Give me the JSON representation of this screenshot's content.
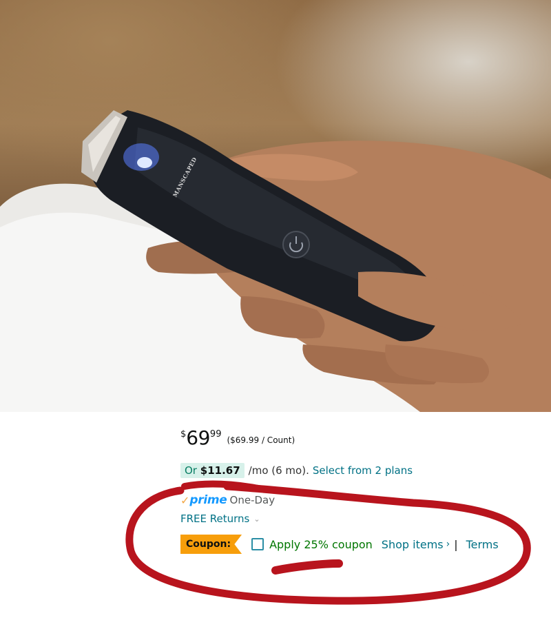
{
  "photo": {
    "alt": "Hand holding a black body hair trimmer with blue light",
    "brand_mark": "MANSCAPED"
  },
  "price": {
    "symbol": "$",
    "whole": "69",
    "fraction": "99",
    "per_unit": "($69.99 / Count)"
  },
  "installment": {
    "prefix": "Or",
    "amount": "$11.67",
    "term": "/mo (6 mo).",
    "link": "Select from 2 plans"
  },
  "prime": {
    "check": "✓",
    "word": "prime",
    "speed": "One-Day"
  },
  "returns": {
    "label": "FREE Returns",
    "chevron": "⌄"
  },
  "coupon": {
    "badge": "Coupon:",
    "apply": "Apply 25% coupon",
    "shop": "Shop items",
    "shop_arrow": "›",
    "separator": "|",
    "terms": "Terms"
  },
  "colors": {
    "link": "#007185",
    "coupon_green": "#007600",
    "coupon_badge": "#f79e0b",
    "prime_blue": "#1399ff",
    "annotation_red": "#b8141d"
  }
}
